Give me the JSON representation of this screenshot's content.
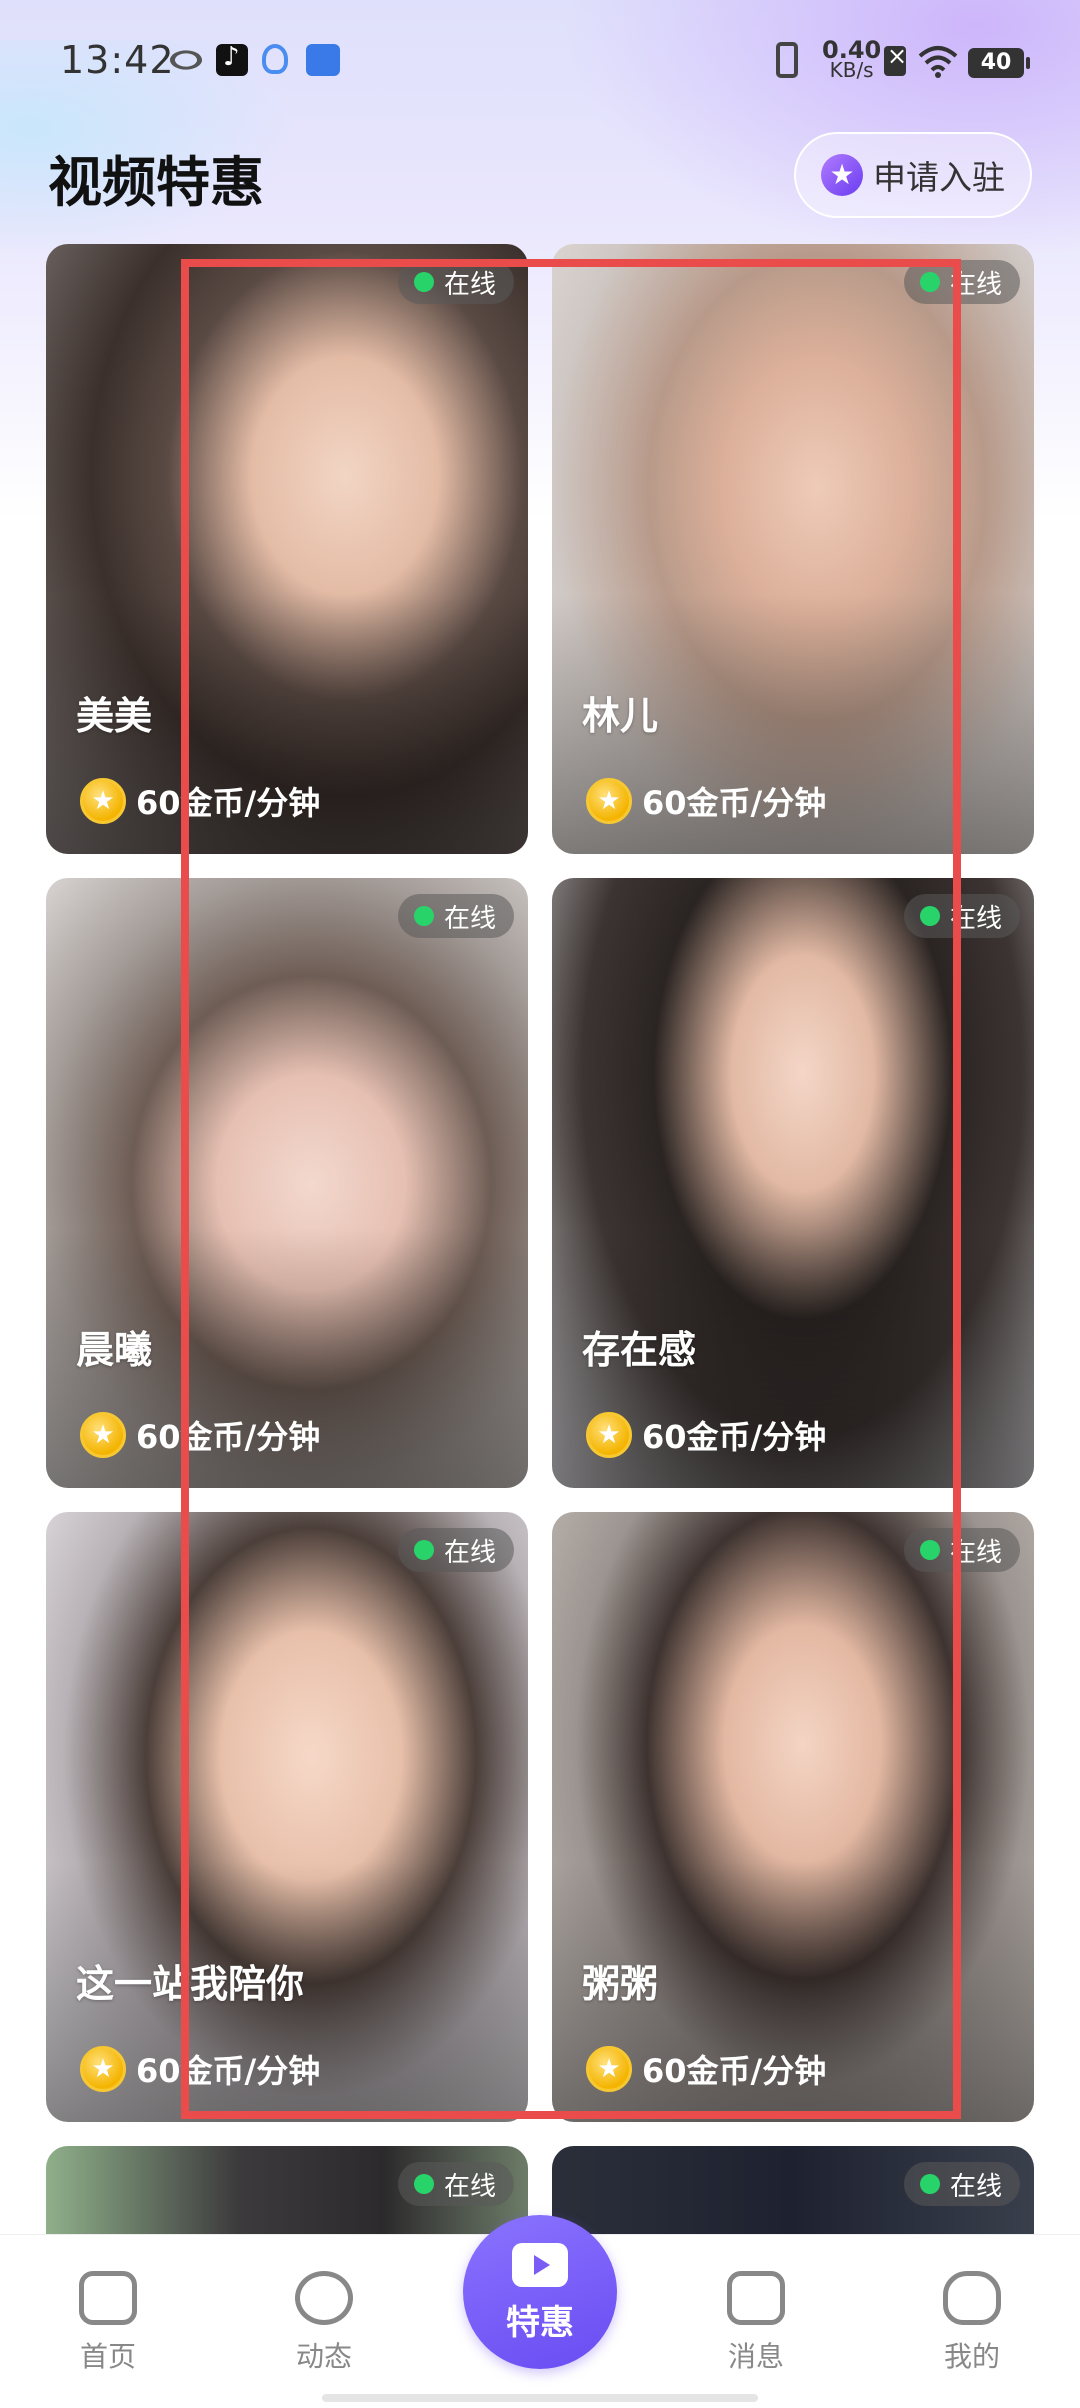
{
  "status_bar": {
    "time": "13:42",
    "net_speed_value": "0.40",
    "net_speed_unit": "KB/s",
    "battery": "40",
    "icons": [
      "link-icon",
      "tiktok-icon",
      "qq-icon",
      "app-icon",
      "vibrate-icon",
      "x-icon",
      "wifi-icon",
      "battery-icon"
    ]
  },
  "header": {
    "title": "视频特惠",
    "apply_button": "申请入驻",
    "apply_icon": "star-icon"
  },
  "cards": [
    {
      "name": "美美",
      "status": "在线",
      "price": "60金币/分钟"
    },
    {
      "name": "林儿",
      "status": "在线",
      "price": "60金币/分钟"
    },
    {
      "name": "晨曦",
      "status": "在线",
      "price": "60金币/分钟"
    },
    {
      "name": "存在感",
      "status": "在线",
      "price": "60金币/分钟"
    },
    {
      "name": "这一站我陪你",
      "status": "在线",
      "price": "60金币/分钟"
    },
    {
      "name": "粥粥",
      "status": "在线",
      "price": "60金币/分钟"
    },
    {
      "name": "",
      "status": "在线",
      "price": ""
    },
    {
      "name": "",
      "status": "在线",
      "price": ""
    }
  ],
  "nav": {
    "home": "首页",
    "moments": "动态",
    "special": "特惠",
    "messages": "消息",
    "mine": "我的"
  },
  "colors": {
    "accent": "#7b5cf6",
    "online": "#28d46a",
    "coin": "#f4b400",
    "highlight": "#ea4b4b"
  }
}
